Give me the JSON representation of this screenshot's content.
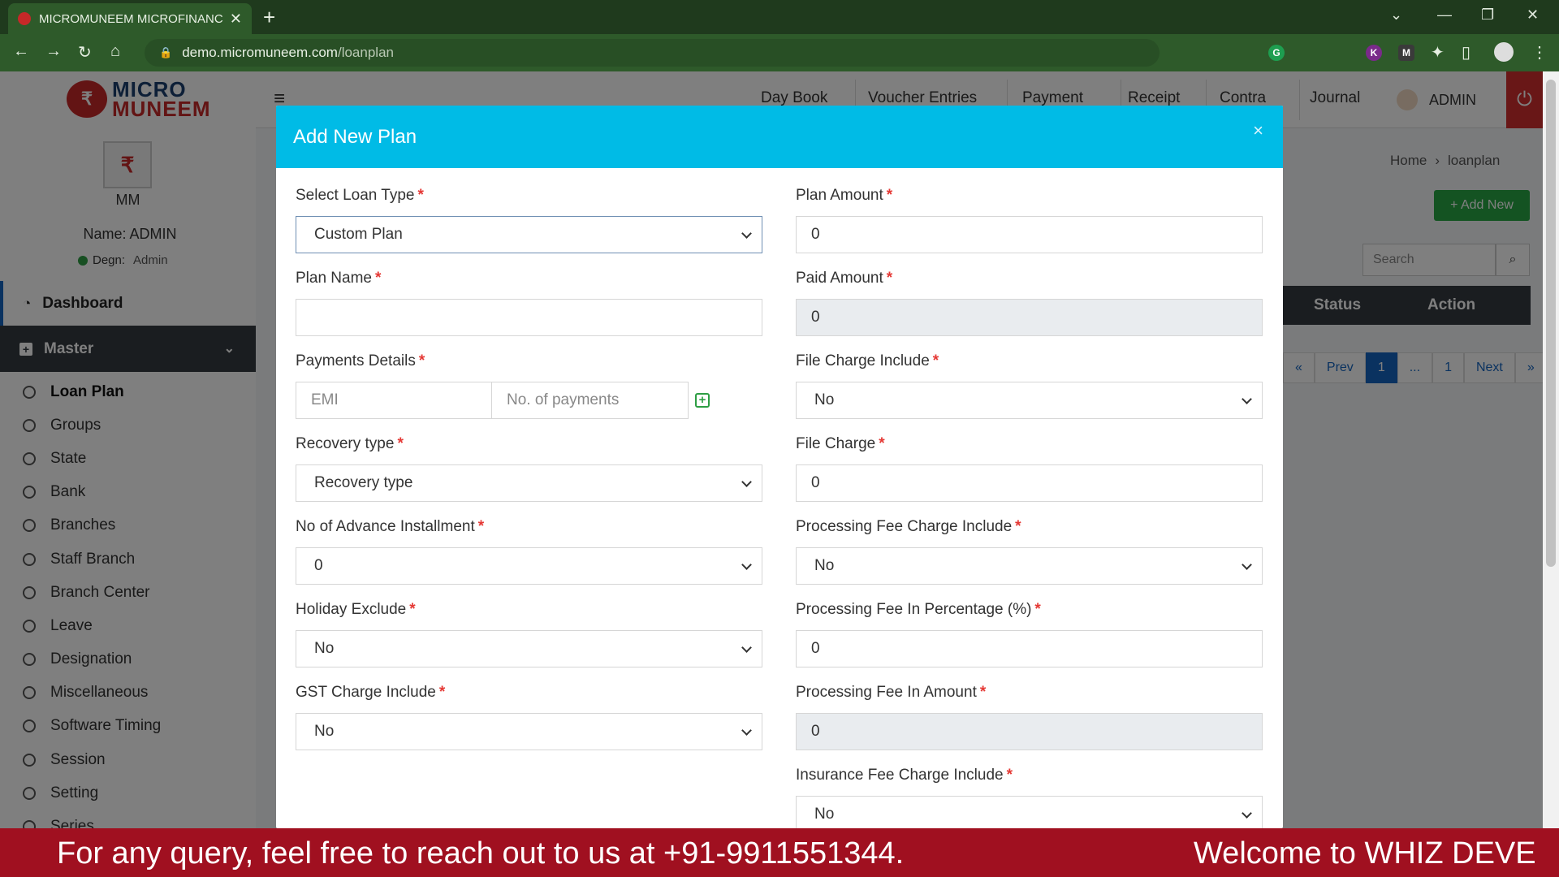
{
  "browser": {
    "tab_title": "MICROMUNEEM MICROFINANCE",
    "url_host": "demo.micromuneem.com",
    "url_path": "/loanplan",
    "extensions": [
      "G",
      "K",
      "M"
    ]
  },
  "logo": {
    "word1": "MICRO",
    "word2": "MUNEEM"
  },
  "user": {
    "initials": "MM",
    "name": "Name: ADMIN",
    "degn_label": "Degn:",
    "degn_value": "Admin"
  },
  "sidebar": {
    "dashboard": "Dashboard",
    "master": "Master",
    "items": [
      {
        "label": "Loan Plan"
      },
      {
        "label": "Groups"
      },
      {
        "label": "State"
      },
      {
        "label": "Bank"
      },
      {
        "label": "Branches"
      },
      {
        "label": "Staff Branch"
      },
      {
        "label": "Branch Center"
      },
      {
        "label": "Leave"
      },
      {
        "label": "Designation"
      },
      {
        "label": "Miscellaneous"
      },
      {
        "label": "Software Timing"
      },
      {
        "label": "Session"
      },
      {
        "label": "Setting"
      },
      {
        "label": "Series"
      }
    ]
  },
  "topnav": {
    "items": [
      "Day Book",
      "Voucher Entries",
      "Payment",
      "Receipt",
      "Contra",
      "Journal"
    ],
    "admin": "ADMIN"
  },
  "breadcrumb": {
    "home": "Home",
    "sep": "›",
    "current": "loanplan"
  },
  "actions": {
    "add_new": "+ Add New",
    "search_placeholder": "Search"
  },
  "table": {
    "headers": [
      "Status",
      "Action"
    ]
  },
  "pager": [
    "«",
    "Prev",
    "1",
    "...",
    "1",
    "Next",
    "»"
  ],
  "modal": {
    "title": "Add New Plan",
    "close": "×",
    "left_fields": [
      {
        "label": "Select Loan Type",
        "value": "Custom Plan"
      },
      {
        "label": "Plan Name",
        "value": ""
      },
      {
        "label": "Payments Details",
        "emi_placeholder": "EMI",
        "count_placeholder": "No. of payments"
      },
      {
        "label": "Recovery type",
        "value": "Recovery type"
      },
      {
        "label": "No of Advance Installment",
        "value": "0"
      },
      {
        "label": "Holiday Exclude",
        "value": "No"
      },
      {
        "label": "GST Charge Include",
        "value": "No"
      }
    ],
    "right_fields": [
      {
        "label": "Plan Amount",
        "value": "0"
      },
      {
        "label": "Paid Amount",
        "value": "0"
      },
      {
        "label": "File Charge Include",
        "value": "No"
      },
      {
        "label": "File Charge",
        "value": "0"
      },
      {
        "label": "Processing Fee Charge Include",
        "value": "No"
      },
      {
        "label": "Processing Fee In Percentage (%)",
        "value": "0"
      },
      {
        "label": "Processing Fee In Amount",
        "value": "0"
      },
      {
        "label": "Insurance Fee Charge Include",
        "value": "No"
      }
    ],
    "required_mark": "*"
  },
  "ticker": {
    "text1": "For any query, feel free to reach out to us at +91-9911551344.",
    "text2": "Welcome to WHIZ DEVE"
  },
  "colors": {
    "modal_header": "#00bbe6",
    "ticker_bg": "#a01020",
    "add_new": "#28a745",
    "primary": "#1565c0"
  }
}
